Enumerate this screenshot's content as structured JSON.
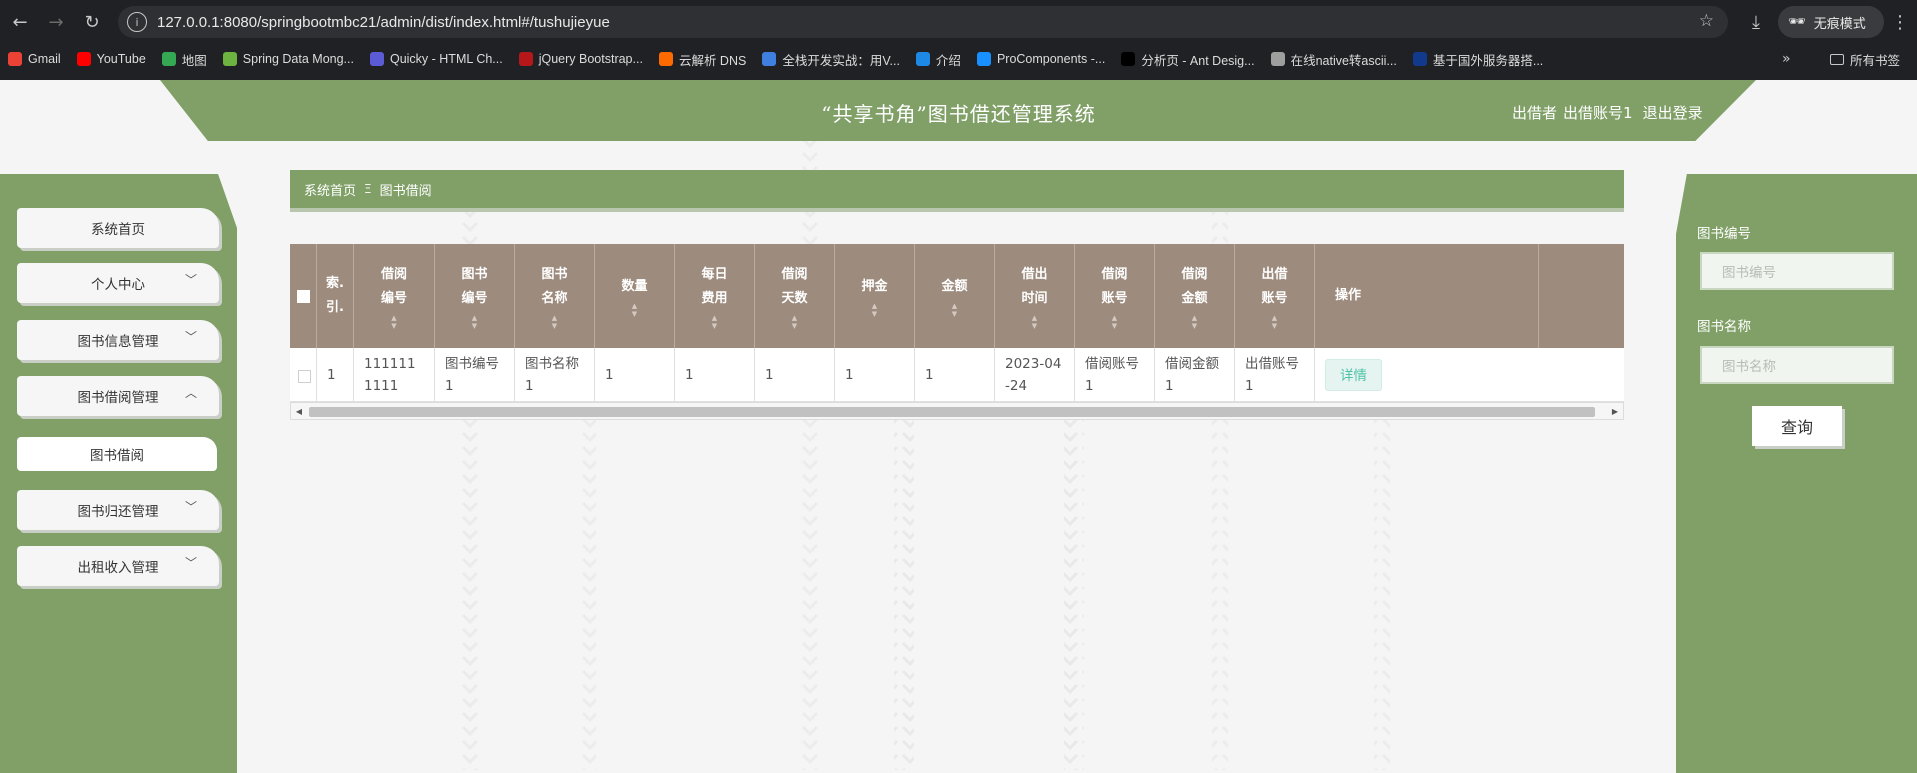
{
  "browser": {
    "url": "127.0.0.1:8080/springbootmbc21/admin/dist/index.html#/tushujieyue",
    "incognito_label": "无痕模式",
    "bookmarks": [
      {
        "label": "Gmail",
        "color": "#ea4335"
      },
      {
        "label": "YouTube",
        "color": "#ff0000"
      },
      {
        "label": "地图",
        "color": "#34a853"
      },
      {
        "label": "Spring Data Mong...",
        "color": "#6db33f"
      },
      {
        "label": "Quicky - HTML Ch...",
        "color": "#5b5bd6"
      },
      {
        "label": "jQuery Bootstrap...",
        "color": "#b5171a"
      },
      {
        "label": "云解析 DNS",
        "color": "#ff6a00"
      },
      {
        "label": "全栈开发实战：用V...",
        "color": "#3f7fe0"
      },
      {
        "label": "介绍",
        "color": "#1e88e5"
      },
      {
        "label": "ProComponents -...",
        "color": "#1890ff"
      },
      {
        "label": "分析页 - Ant Desig...",
        "color": "#000000"
      },
      {
        "label": "在线native转ascii...",
        "color": "#9e9e9e"
      },
      {
        "label": "基于国外服务器搭...",
        "color": "#123a8c"
      }
    ],
    "all_bookmarks_label": "所有书签"
  },
  "header": {
    "title": "“共享书角”图书借还管理系统",
    "role": "出借者",
    "account": "出借账号1",
    "logout": "退出登录"
  },
  "sidebar": {
    "items": [
      {
        "label": "系统首页",
        "expandable": false
      },
      {
        "label": "个人中心",
        "expandable": true,
        "expanded": false
      },
      {
        "label": "图书信息管理",
        "expandable": true,
        "expanded": false
      },
      {
        "label": "图书借阅管理",
        "expandable": true,
        "expanded": true
      },
      {
        "label": "图书借阅",
        "sub": true
      },
      {
        "label": "图书归还管理",
        "expandable": true,
        "expanded": false
      },
      {
        "label": "出租收入管理",
        "expandable": true,
        "expanded": false
      }
    ]
  },
  "breadcrumb": {
    "home": "系统首页",
    "separator": "Ξ",
    "current": "图书借阅"
  },
  "table": {
    "columns": [
      {
        "label": "",
        "lines": [
          "■."
        ],
        "sortable": false
      },
      {
        "label": "索引",
        "lines": [
          "索.",
          "引."
        ],
        "sortable": false
      },
      {
        "label": "借阅编号",
        "lines": [
          "借阅",
          "编号"
        ],
        "sortable": true
      },
      {
        "label": "图书编号",
        "lines": [
          "图书",
          "编号"
        ],
        "sortable": true
      },
      {
        "label": "图书名称",
        "lines": [
          "图书",
          "名称"
        ],
        "sortable": true
      },
      {
        "label": "数量",
        "lines": [
          "数量"
        ],
        "sortable": true
      },
      {
        "label": "每日费用",
        "lines": [
          "每日",
          "费用"
        ],
        "sortable": true
      },
      {
        "label": "借阅天数",
        "lines": [
          "借阅",
          "天数"
        ],
        "sortable": true
      },
      {
        "label": "押金",
        "lines": [
          "押金"
        ],
        "sortable": true
      },
      {
        "label": "金额",
        "lines": [
          "金额"
        ],
        "sortable": true
      },
      {
        "label": "借出时间",
        "lines": [
          "借出",
          "时间"
        ],
        "sortable": true
      },
      {
        "label": "借阅账号",
        "lines": [
          "借阅",
          "账号"
        ],
        "sortable": true
      },
      {
        "label": "借阅金额",
        "lines": [
          "借阅",
          "金额"
        ],
        "sortable": true
      },
      {
        "label": "出借账号",
        "lines": [
          "出借",
          "账号"
        ],
        "sortable": true
      },
      {
        "label": "操作",
        "lines": [
          "操作"
        ],
        "sortable": false
      }
    ],
    "rows": [
      {
        "cells": [
          "",
          "1",
          "1111111111",
          "图书编号1",
          "图书名称1",
          "1",
          "1",
          "1",
          "1",
          "1",
          "2023-04-24",
          "借阅账号1",
          "借阅金额1",
          "出借账号1"
        ],
        "action": "详情"
      }
    ]
  },
  "search": {
    "book_no_label": "图书编号",
    "book_no_placeholder": "图书编号",
    "book_name_label": "图书名称",
    "book_name_placeholder": "图书名称",
    "query_button": "查询"
  },
  "colors": {
    "theme_green": "#80a068",
    "table_header": "#9d8b7e",
    "detail_text": "#4ec2a8"
  }
}
